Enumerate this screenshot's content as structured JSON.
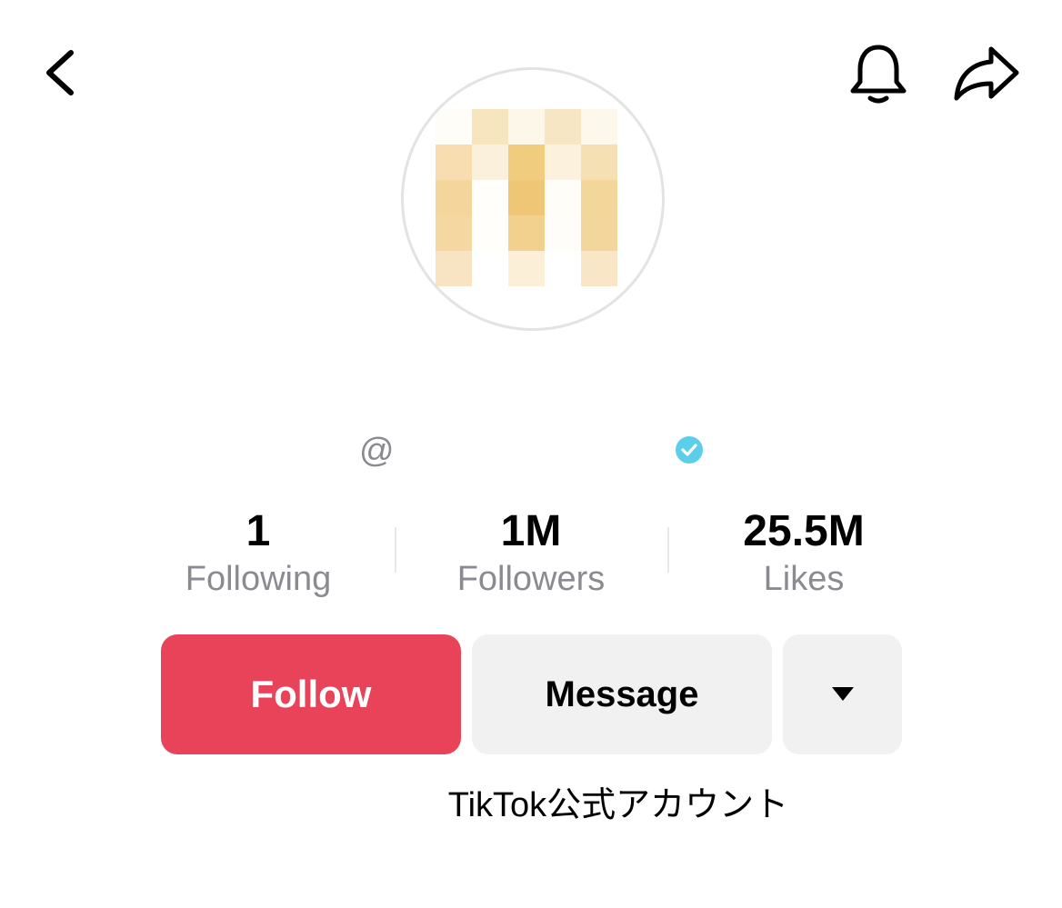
{
  "header": {
    "back_icon": "chevron-left-icon",
    "notification_icon": "bell-icon",
    "share_icon": "share-arrow-icon"
  },
  "profile": {
    "avatar_icon": "pixelated-avatar",
    "at_symbol": "@",
    "verified_icon": "verified-check-icon",
    "verified_color": "#20d5ec"
  },
  "stats": [
    {
      "value": "1",
      "label": "Following"
    },
    {
      "value": "1M",
      "label": "Followers"
    },
    {
      "value": "25.5M",
      "label": "Likes"
    }
  ],
  "actions": {
    "follow_label": "Follow",
    "message_label": "Message",
    "more_icon": "caret-down-icon",
    "follow_color": "#e9435a"
  },
  "bio": "TikTok公式アカウント"
}
